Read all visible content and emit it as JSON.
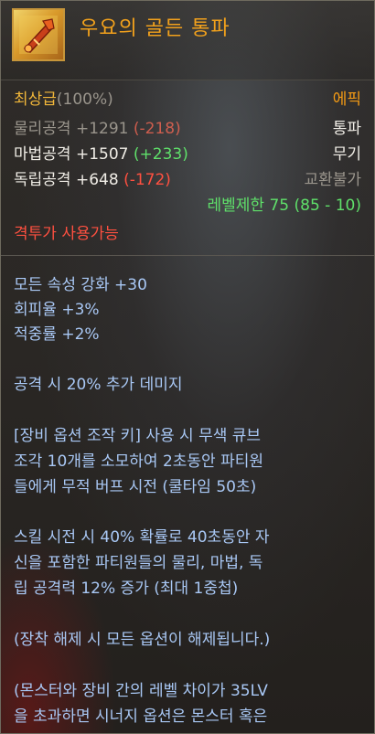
{
  "item": {
    "name": "우요의 골든 통파",
    "icon": "golden-tonfa-icon"
  },
  "stats": {
    "grade": "최상급",
    "grade_pct": "(100%)",
    "rarity": "에픽",
    "physical_label": "물리공격",
    "physical_value": "+1291",
    "physical_diff": "(-218)",
    "item_type": "통파",
    "magic_label": "마법공격",
    "magic_value": "+1507",
    "magic_diff": "(+233)",
    "slot": "무기",
    "indep_label": "독립공격",
    "indep_value": "+648",
    "indep_diff": "(-172)",
    "trade": "교환불가",
    "level_limit": "레벨제한 75 (85 - 10)",
    "class_usable": "격투가 사용가능"
  },
  "description": {
    "line1": "모든 속성 강화 +30",
    "line2": "회피율 +3%",
    "line3": "적중률 +2%",
    "line4": "공격 시 20% 추가 데미지",
    "line5": "[장비 옵션 조작 키] 사용 시 무색 큐브",
    "line6": "조각 10개를 소모하여 2초동안 파티원",
    "line7": "들에게 무적 버프 시전 (쿨타임 50초)",
    "line8": "스킬 시전 시 40% 확률로 40초동안 자",
    "line9": "신을 포함한 파티원들의 물리, 마법, 독",
    "line10": "립 공격력 12% 증가 (최대 1중첩)",
    "line11": "(장착 해제 시 모든 옵션이 해제됩니다.)",
    "line12": "(몬스터와 장비 간의 레벨 차이가 35LV",
    "line13": "을 초과하면 시너지 옵션은 몬스터 혹은"
  },
  "colors": {
    "gold": "#f0b63a",
    "gray": "#9a958c",
    "green": "#5fe06a",
    "red": "#ff5040",
    "orange": "#f39a14",
    "blue": "#a9c8f5"
  }
}
